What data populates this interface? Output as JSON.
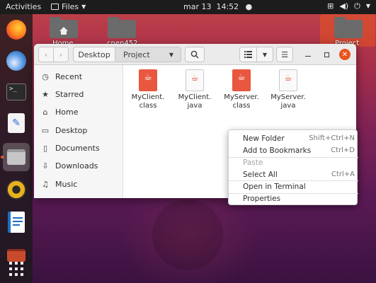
{
  "topbar": {
    "activities": "Activities",
    "app_menu": "Files",
    "clock": "mar 13  14:52",
    "tray_icons": [
      "network-icon",
      "volume-icon",
      "power-icon",
      "chevron-down-icon"
    ]
  },
  "dock": {
    "apps": [
      "firefox",
      "thunderbird",
      "terminal",
      "text-editor",
      "files",
      "rhythmbox",
      "writer",
      "software",
      "show-apps"
    ],
    "active": "files"
  },
  "desktop": {
    "icons": [
      {
        "name": "Home",
        "kind": "home-folder"
      },
      {
        "name": "cnen452",
        "kind": "folder"
      },
      {
        "name": "Project",
        "kind": "folder"
      }
    ]
  },
  "window": {
    "path": [
      "Desktop",
      "Project"
    ],
    "sidebar": [
      {
        "label": "Recent",
        "icon": "clock-icon"
      },
      {
        "label": "Starred",
        "icon": "star-icon"
      },
      {
        "label": "Home",
        "icon": "home-icon"
      },
      {
        "label": "Desktop",
        "icon": "desktop-icon"
      },
      {
        "label": "Documents",
        "icon": "document-icon"
      },
      {
        "label": "Downloads",
        "icon": "download-icon"
      },
      {
        "label": "Music",
        "icon": "music-icon"
      }
    ],
    "files": [
      {
        "line1": "MyClient.",
        "line2": "class",
        "type": "class"
      },
      {
        "line1": "MyClient.",
        "line2": "java",
        "type": "java"
      },
      {
        "line1": "MyServer.",
        "line2": "class",
        "type": "class"
      },
      {
        "line1": "MyServer.",
        "line2": "java",
        "type": "java"
      }
    ]
  },
  "context_menu": {
    "items": [
      {
        "label": "New Folder",
        "accel": "Shift+Ctrl+N",
        "enabled": true
      },
      {
        "label": "Add to Bookmarks",
        "accel": "Ctrl+D",
        "enabled": true
      },
      {
        "label": "Paste",
        "accel": "",
        "enabled": false
      },
      {
        "label": "Select All",
        "accel": "Ctrl+A",
        "enabled": true
      },
      {
        "label": "Open in Terminal",
        "accel": "",
        "enabled": true
      },
      {
        "label": "Properties",
        "accel": "",
        "enabled": true
      }
    ]
  },
  "colors": {
    "accent": "#e95420",
    "close": "#e95420",
    "menu_disabled": "#a5a5a5"
  }
}
